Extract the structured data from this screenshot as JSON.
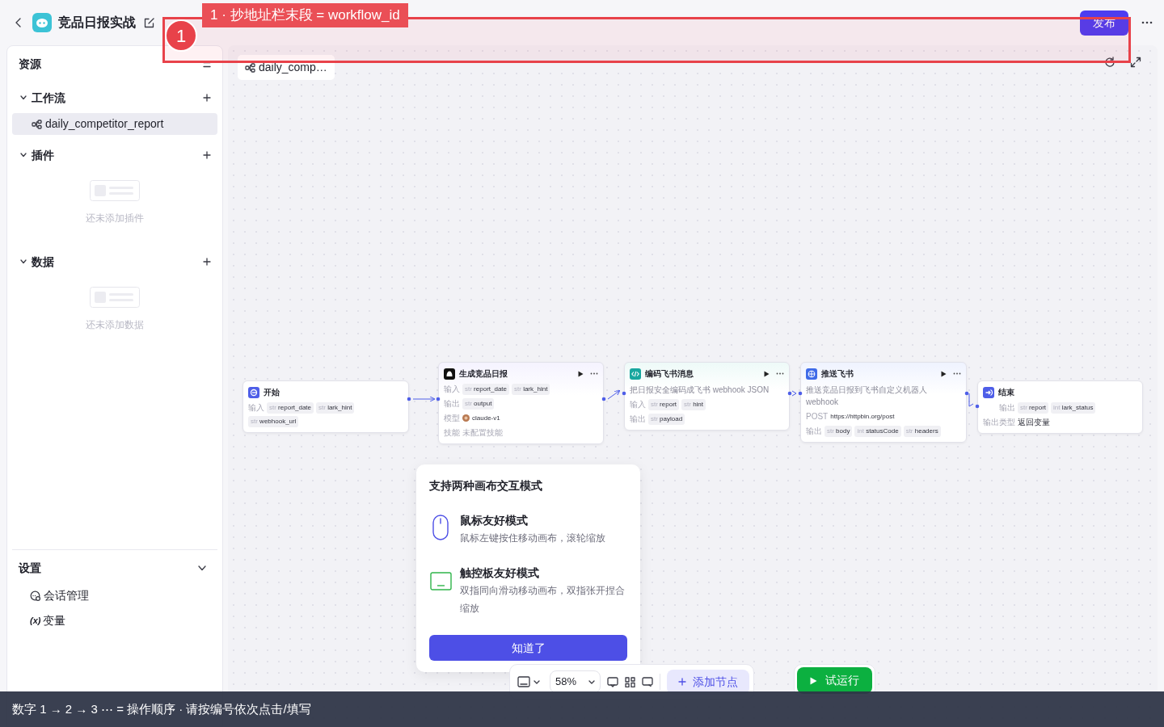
{
  "header": {
    "title": "竞品日报实战",
    "publish": "发布"
  },
  "sidebar": {
    "title": "资源",
    "sections": [
      {
        "label": "工作流",
        "expanded": true,
        "items": [
          {
            "label": "daily_competitor_report",
            "selected": true
          }
        ]
      },
      {
        "label": "插件",
        "expanded": true,
        "empty_text": "还未添加插件"
      },
      {
        "label": "数据",
        "expanded": true,
        "empty_text": "还未添加数据"
      }
    ],
    "settings": {
      "label": "设置",
      "expanded": true,
      "items": [
        {
          "kind": "chat",
          "label": "会话管理"
        },
        {
          "kind": "variable",
          "icon_text": "(x)",
          "label": "变量"
        }
      ]
    }
  },
  "canvas": {
    "tab": "daily_comp…",
    "nodes": [
      {
        "kind": "start",
        "title": "开始",
        "debuggable": false,
        "rows": [
          {
            "kind": "params",
            "label": "输入",
            "params": [
              {
                "type": "str",
                "name": "report_date"
              },
              {
                "type": "str",
                "name": "lark_hint"
              },
              {
                "type": "str",
                "name": "webhook_url"
              }
            ]
          }
        ]
      },
      {
        "kind": "llm",
        "title": "生成竞品日报",
        "debuggable": true,
        "rows": [
          {
            "kind": "params",
            "label": "输入",
            "params": [
              {
                "type": "str",
                "name": "report_date"
              },
              {
                "type": "str",
                "name": "lark_hint"
              }
            ]
          },
          {
            "kind": "params",
            "label": "输出",
            "params": [
              {
                "type": "str",
                "name": "output"
              }
            ]
          },
          {
            "kind": "model",
            "label": "模型",
            "text": "claude-v1"
          },
          {
            "kind": "empty",
            "label": "技能",
            "text": "未配置技能"
          }
        ]
      },
      {
        "kind": "code",
        "title": "编码飞书消息",
        "debuggable": true,
        "description": "把日报安全编码成飞书 webhook JSON",
        "rows": [
          {
            "kind": "params",
            "label": "输入",
            "params": [
              {
                "type": "str",
                "name": "report"
              },
              {
                "type": "str",
                "name": "hint"
              }
            ]
          },
          {
            "kind": "params",
            "label": "输出",
            "params": [
              {
                "type": "str",
                "name": "payload"
              }
            ]
          }
        ]
      },
      {
        "kind": "http",
        "title": "推送飞书",
        "debuggable": true,
        "description": "推送竞品日报到飞书自定义机器人 webhook",
        "rows": [
          {
            "kind": "text",
            "label": "POST",
            "text": "https://httpbin.org/post"
          },
          {
            "kind": "params",
            "label": "输出",
            "params": [
              {
                "type": "str",
                "name": "body"
              },
              {
                "type": "int",
                "name": "statusCode"
              },
              {
                "type": "str",
                "name": "headers"
              }
            ]
          }
        ]
      },
      {
        "kind": "end",
        "title": "结束",
        "debuggable": false,
        "rows": [
          {
            "kind": "params",
            "label": "输出",
            "params": [
              {
                "type": "str",
                "name": "report"
              },
              {
                "type": "int",
                "name": "lark_status"
              }
            ]
          },
          {
            "kind": "text",
            "label": "输出类型",
            "text": "返回变量"
          }
        ]
      }
    ]
  },
  "popover": {
    "title": "支持两种画布交互模式",
    "modes": [
      {
        "kind": "mouse",
        "title": "鼠标友好模式",
        "description": "鼠标左键按住移动画布，滚轮缩放"
      },
      {
        "kind": "trackpad",
        "title": "触控板友好模式",
        "description": "双指同向滑动移动画布，双指张开捏合缩放"
      }
    ],
    "button": "知道了"
  },
  "toolbar": {
    "zoom": "58%",
    "add_node": "添加节点",
    "run": "试运行"
  },
  "annotation": {
    "number": "1",
    "label": "1 ·  抄地址栏末段 = workflow_id"
  },
  "hint_bar": "数字 1 → 2 → 3 ⋯ = 操作顺序 ·  请按编号依次点击/填写"
}
